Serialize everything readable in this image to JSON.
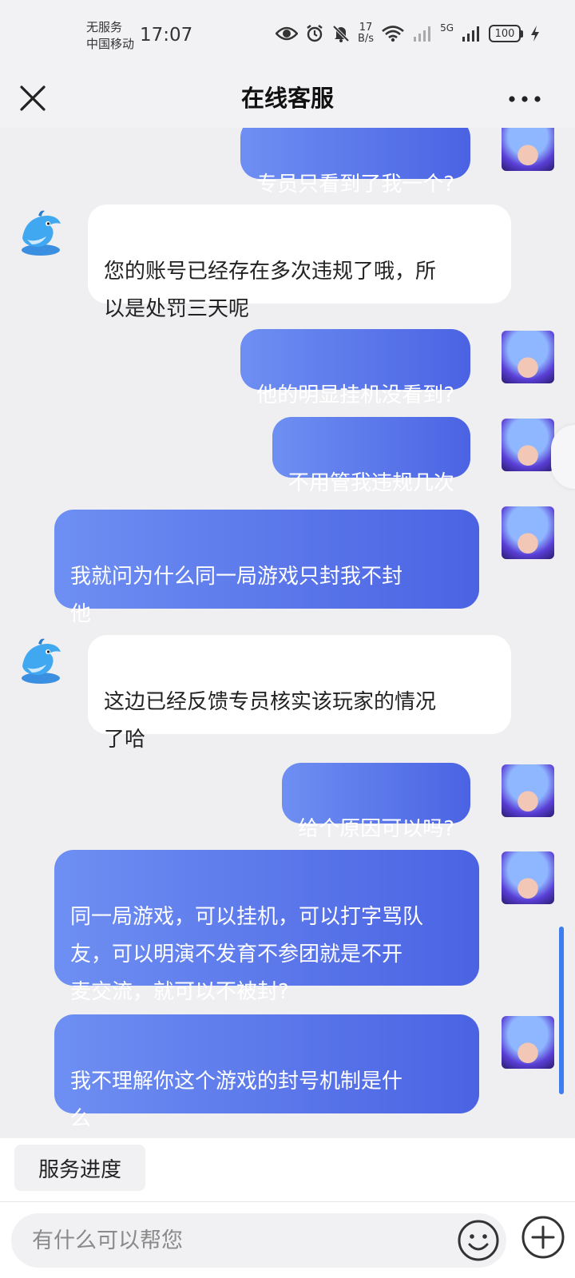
{
  "status_bar": {
    "carrier_line1": "无服务",
    "carrier_line2": "中国移动",
    "time": "17:07",
    "net_speed_value": "17",
    "net_speed_unit": "B/s",
    "network_type": "5G",
    "battery": "100",
    "icons": [
      "eye-icon",
      "alarm-icon",
      "mute-icon",
      "wifi-icon",
      "signal-icon",
      "charging-icon"
    ]
  },
  "nav": {
    "title": "在线客服",
    "close_icon": "close-icon",
    "more_icon": "more-icon"
  },
  "messages": [
    {
      "sender": "user",
      "text": "专员只看到了我一个?"
    },
    {
      "sender": "agent",
      "text": "您的账号已经存在多次违规了哦，所\n以是处罚三天呢"
    },
    {
      "sender": "user",
      "text": "他的明显挂机没看到?"
    },
    {
      "sender": "user",
      "text": "不用管我违规几次"
    },
    {
      "sender": "user",
      "text": "我就问为什么同一局游戏只封我不封\n他"
    },
    {
      "sender": "agent",
      "text": "这边已经反馈专员核实该玩家的情况\n了哈"
    },
    {
      "sender": "user",
      "text": "给个原因可以吗?"
    },
    {
      "sender": "user",
      "text": "同一局游戏，可以挂机，可以打字骂队\n友，可以明演不发育不参团就是不开\n麦交流，就可以不被封?"
    },
    {
      "sender": "user",
      "text": "我不理解你这个游戏的封号机制是什\n么"
    }
  ],
  "quick_actions": {
    "service_progress": "服务进度"
  },
  "input": {
    "placeholder": "有什么可以帮您",
    "value": "",
    "emoji_icon": "emoji-icon",
    "plus_icon": "plus-icon"
  },
  "colors": {
    "user_bubble_start": "#6e8ff2",
    "user_bubble_end": "#4b63e3",
    "agent_bubble": "#ffffff",
    "background": "#efeff1",
    "scroll_indicator": "#3d7df0"
  }
}
